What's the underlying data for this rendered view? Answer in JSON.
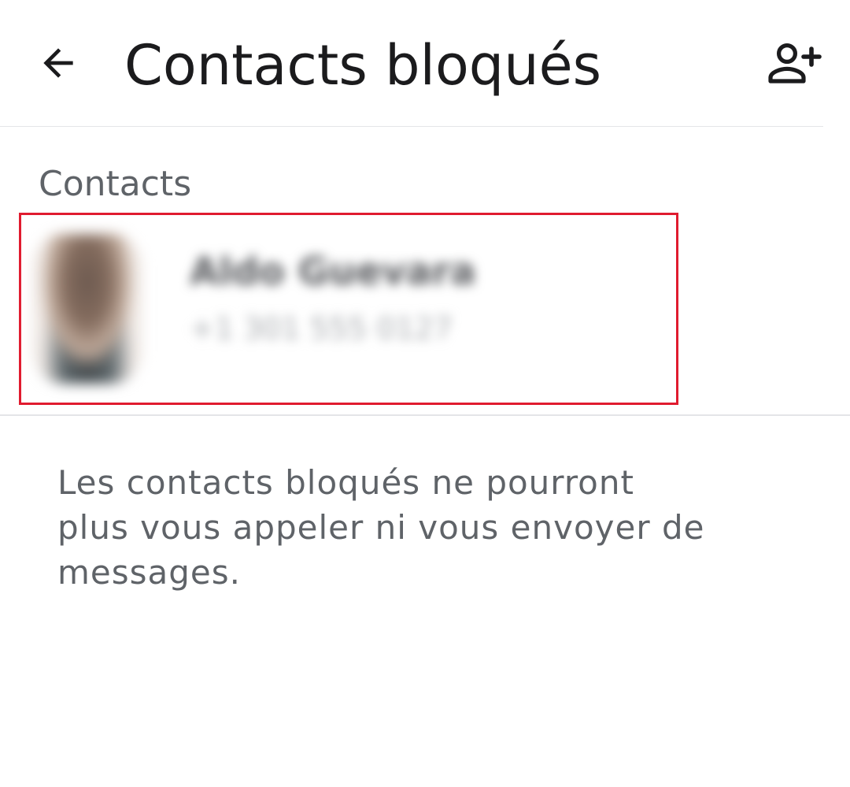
{
  "app_bar": {
    "back_icon": "arrow-back-icon",
    "title": "Contacts bloqués",
    "add_icon": "person-add-icon"
  },
  "section": {
    "header": "Contacts"
  },
  "blocked_contacts": [
    {
      "name": "Aldo Guevara",
      "phone": "+1 301 555 0127",
      "obscured": true
    }
  ],
  "info": {
    "lines": [
      "Les contacts bloqués ne pourront",
      "plus vous appeler ni vous envoyer de",
      "messages."
    ]
  },
  "colors": {
    "title_text": "#1b1b1d",
    "secondary_text": "#5f6368",
    "divider": "#e4e5e8",
    "highlight_border": "#e01b2f",
    "background": "#ffffff"
  }
}
